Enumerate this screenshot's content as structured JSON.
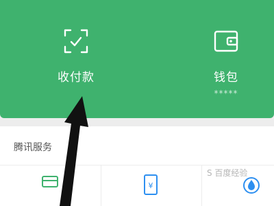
{
  "quick_actions": {
    "pay": {
      "label": "收付款",
      "icon": "scan-frame-icon"
    },
    "wallet": {
      "label": "钱包",
      "masked_balance": "*****",
      "icon": "wallet-icon"
    }
  },
  "services": {
    "title": "腾讯服务",
    "items": [
      {
        "icon": "card-icon"
      },
      {
        "icon": "mobile-recharge-icon"
      },
      {
        "icon": "water-drop-icon"
      }
    ]
  },
  "watermark": {
    "text": "S 百度经验"
  },
  "annotation": {
    "icon": "pointer-arrow-icon"
  },
  "colors": {
    "primary_green": "#3fb26e",
    "accent_blue": "#2d8ff0"
  }
}
